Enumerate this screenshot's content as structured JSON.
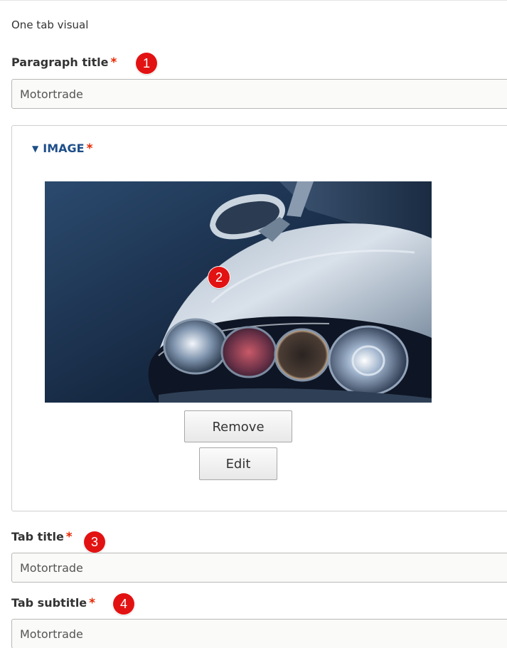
{
  "section": {
    "label": "One tab visual"
  },
  "fields": {
    "paragraph_title": {
      "label": "Paragraph title",
      "required_mark": "*",
      "value": "Motortrade",
      "badge": "1"
    },
    "image": {
      "summary_label": "IMAGE",
      "toggle_glyph": "▼",
      "required_mark": "*",
      "badge": "2",
      "remove_label": "Remove",
      "edit_label": "Edit",
      "icon": "car-headlight-photo"
    },
    "tab_title": {
      "label": "Tab title",
      "required_mark": "*",
      "value": "Motortrade",
      "badge": "3"
    },
    "tab_subtitle": {
      "label": "Tab subtitle",
      "required_mark": "*",
      "value": "Motortrade",
      "badge": "4"
    }
  },
  "colors": {
    "required": "#e62600",
    "summary_link": "#1d4e89",
    "badge": "#e31212",
    "input_background": "#fafaf8",
    "input_border": "#b8b8b8"
  }
}
